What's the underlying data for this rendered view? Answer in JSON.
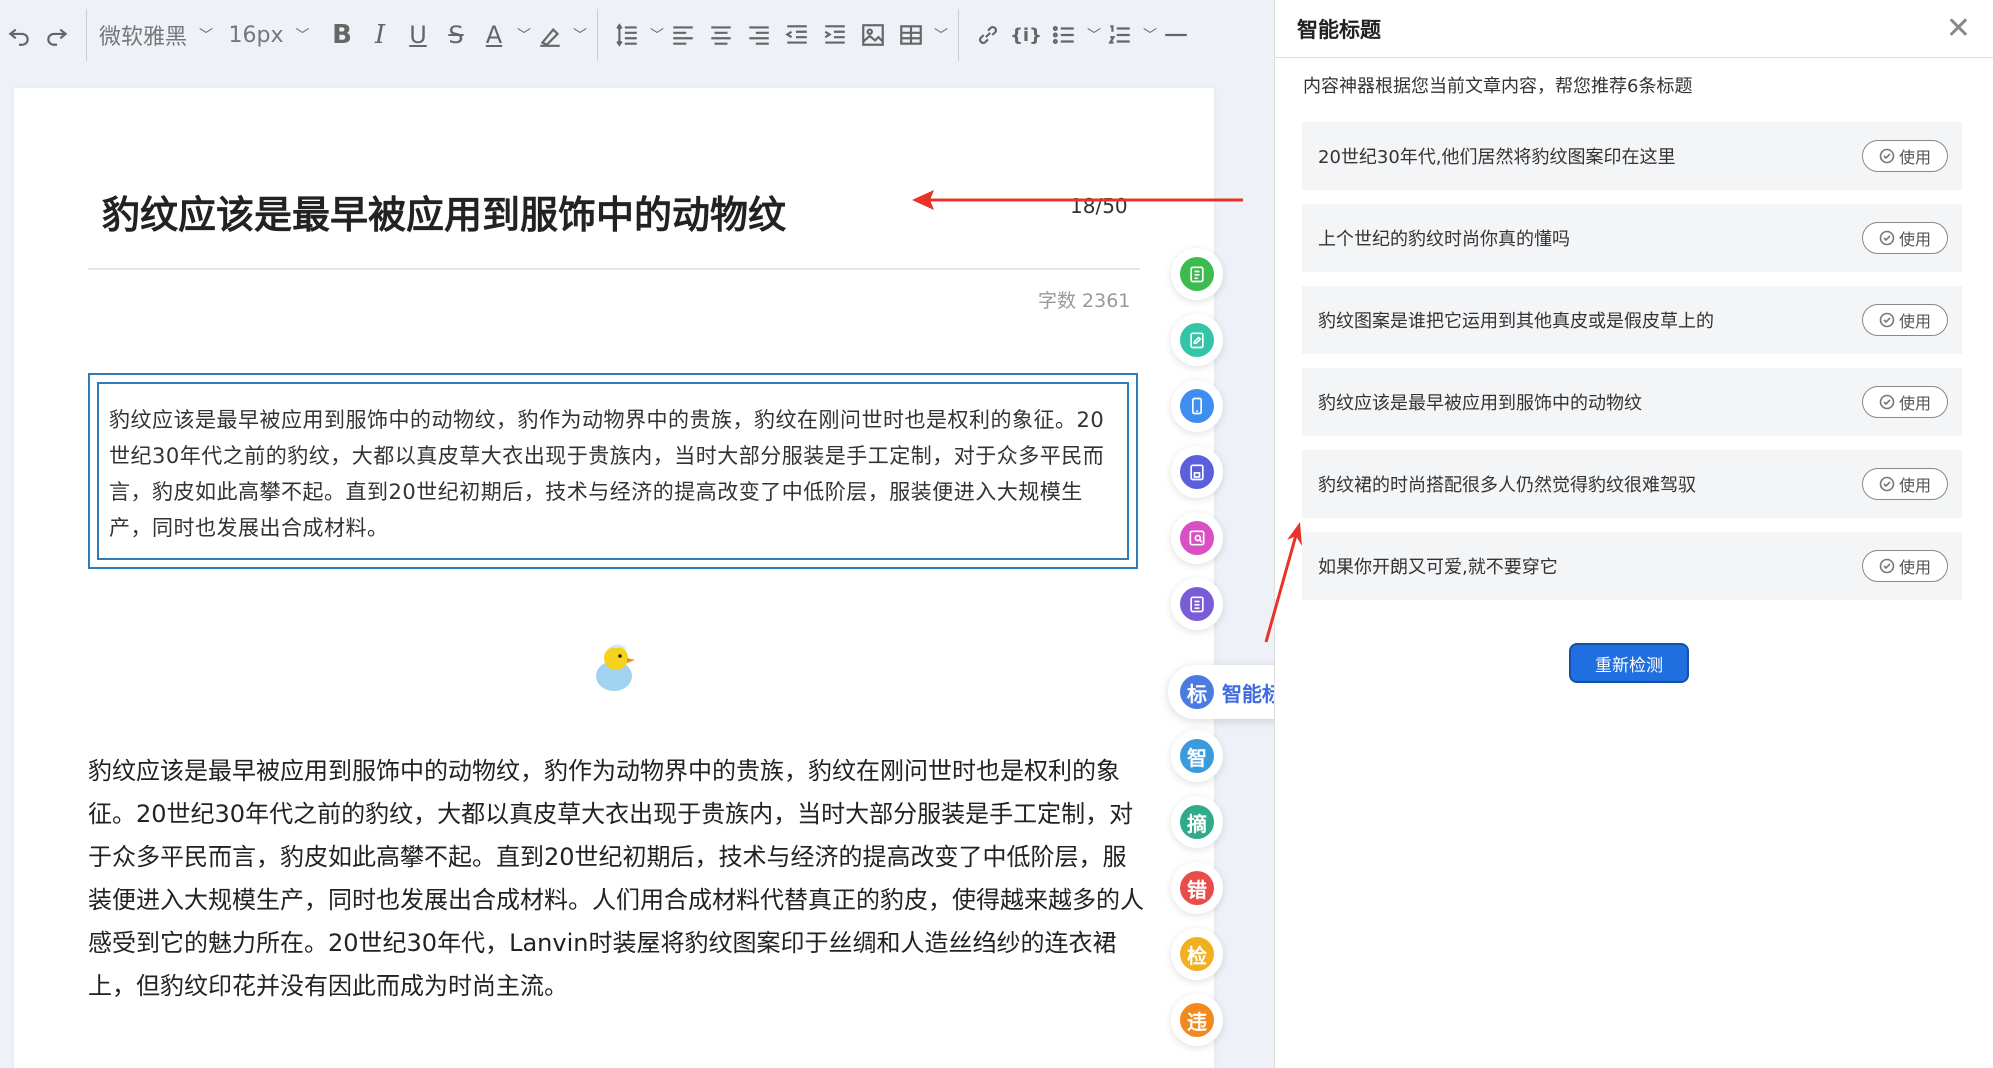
{
  "toolbar": {
    "font_family": "微软雅黑",
    "font_size": "16px"
  },
  "editor": {
    "title": "豹纹应该是最早被应用到服饰中的动物纹",
    "title_count": "18/50",
    "word_count": "字数 2361",
    "summary": "豹纹应该是最早被应用到服饰中的动物纹，豹作为动物界中的贵族，豹纹在刚问世时也是权利的象征。20世纪30年代之前的豹纹，大都以真皮草大衣出现于贵族内，当时大部分服装是手工定制，对于众多平民而言，豹皮如此高攀不起。直到20世纪初期后，技术与经济的提高改变了中低阶层，服装便进入大规模生产，同时也发展出合成材料。",
    "body": "豹纹应该是最早被应用到服饰中的动物纹，豹作为动物界中的贵族，豹纹在刚问世时也是权利的象征。20世纪30年代之前的豹纹，大都以真皮草大衣出现于贵族内，当时大部分服装是手工定制，对于众多平民而言，豹皮如此高攀不起。直到20世纪初期后，技术与经济的提高改变了中低阶层，服装便进入大规模生产，同时也发展出合成材料。人们用合成材料代替真正的豹皮，使得越来越多的人感受到它的魅力所在。20世纪30年代，Lanvin时装屋将豹纹图案印于丝绸和人造丝绉纱的连衣裙上，但豹纹印花并没有因此而成为时尚主流。"
  },
  "fabs": {
    "active_label": "智能标题",
    "active_char": "标",
    "items": [
      "智",
      "摘",
      "错",
      "检",
      "违"
    ],
    "colors": {
      "green1": "#3dbb4f",
      "teal": "#34c4a8",
      "blue": "#3d8ef0",
      "indigo": "#5b5fdc",
      "pink": "#d94fc4",
      "purple": "#7a5cd6",
      "zhi": "#3a9bdc",
      "zhai": "#2faa8a",
      "cuo": "#ea4b4b",
      "jian": "#f0b020",
      "wei": "#f08a1f"
    }
  },
  "panel": {
    "title": "智能标题",
    "description": "内容神器根据您当前文章内容，帮您推荐6条标题",
    "use_label": "使用",
    "recommendations": [
      "20世纪30年代,他们居然将豹纹图案印在这里",
      "上个世纪的豹纹时尚你真的懂吗",
      "豹纹图案是谁把它运用到其他真皮或是假皮草上的",
      "豹纹应该是最早被应用到服饰中的动物纹",
      "豹纹裙的时尚搭配很多人仍然觉得豹纹很难驾驭",
      "如果你开朗又可爱,就不要穿它"
    ],
    "recheck_label": "重新检测"
  }
}
